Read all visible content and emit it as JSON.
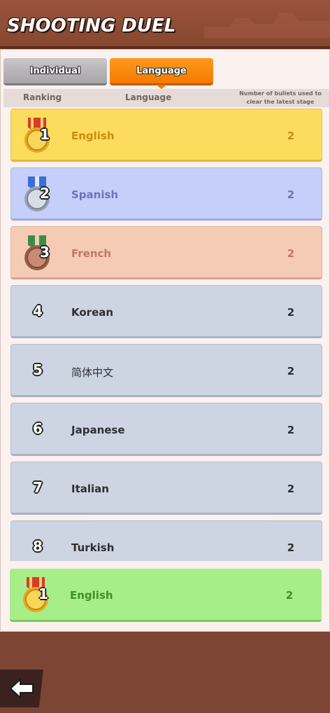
{
  "header": {
    "title": "SHOOTING DUEL"
  },
  "tabs": [
    {
      "label": "Individual",
      "active": false
    },
    {
      "label": "Language",
      "active": true
    }
  ],
  "columns": {
    "ranking": "Ranking",
    "language": "Language",
    "bullets": "Number of bullets used to clear the latest stage"
  },
  "rows": [
    {
      "rank": "1",
      "language": "English",
      "bullets": "2",
      "tier": "gold"
    },
    {
      "rank": "2",
      "language": "Spanish",
      "bullets": "2",
      "tier": "silver"
    },
    {
      "rank": "3",
      "language": "French",
      "bullets": "2",
      "tier": "bronze"
    },
    {
      "rank": "4",
      "language": "Korean",
      "bullets": "2",
      "tier": "plain"
    },
    {
      "rank": "5",
      "language": "简体中文",
      "bullets": "2",
      "tier": "plain"
    },
    {
      "rank": "6",
      "language": "Japanese",
      "bullets": "2",
      "tier": "plain"
    },
    {
      "rank": "7",
      "language": "Italian",
      "bullets": "2",
      "tier": "plain"
    },
    {
      "rank": "8",
      "language": "Turkish",
      "bullets": "2",
      "tier": "plain"
    }
  ],
  "my_entry": {
    "rank": "1",
    "language": "English",
    "bullets": "2",
    "tier": "gold"
  },
  "icons": {
    "back": "back-arrow-icon",
    "medal_gold": "gold-medal-icon",
    "medal_silver": "silver-medal-icon",
    "medal_bronze": "bronze-medal-icon"
  },
  "colors": {
    "tab_active": "#f47a00",
    "gold_row": "#fbdc5c",
    "silver_row": "#c6cffa",
    "bronze_row": "#f6cbb6",
    "plain_row": "#cdd5e3",
    "my_row": "#a7ed88"
  }
}
